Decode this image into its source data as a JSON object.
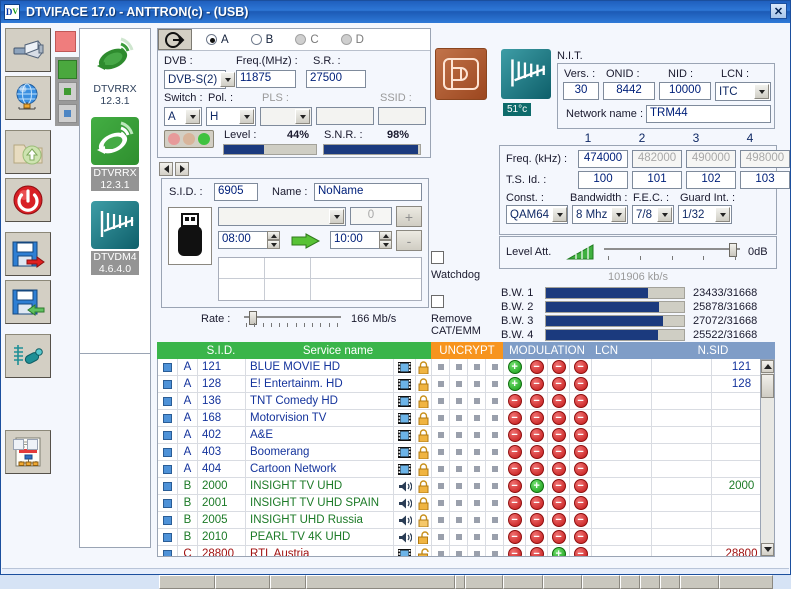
{
  "window": {
    "title": "DTVIFACE 17.0 - ANTTRON(c) - (USB)",
    "close_label": "✕",
    "app_icon": "dtv-logo-icon"
  },
  "toolbar": {
    "buttons": [
      {
        "name": "usb-connect-button",
        "icon": "usb-plug-icon",
        "title": "USB"
      },
      {
        "name": "network-connect-button",
        "icon": "globe-network-icon",
        "title": "Network"
      },
      {
        "name": "open-file-button",
        "icon": "folder-upload-icon",
        "title": "Open"
      },
      {
        "name": "power-button",
        "icon": "power-icon",
        "title": "Power"
      },
      {
        "name": "save-to-device-button",
        "icon": "floppy-arrow-right-icon",
        "title": "Write"
      },
      {
        "name": "read-from-device-button",
        "icon": "floppy-arrow-left-icon",
        "title": "Read"
      },
      {
        "name": "antenna-measure-button",
        "icon": "antenna-meter-icon",
        "title": "Measure"
      },
      {
        "name": "report-button",
        "icon": "report-document-icon",
        "title": "Report"
      }
    ]
  },
  "status_leds": {
    "red": "#e86f6f",
    "green": "#59b04d",
    "small_green": "#59b04d",
    "small_blue": "#5b8fc9"
  },
  "devices": [
    {
      "name": "DTVRRX",
      "version": "12.3.1",
      "selected": false,
      "icon": "satellite-dish-icon"
    },
    {
      "name": "DTVRRX",
      "version": "12.3.1",
      "selected": true,
      "icon": "satellite-dish-icon"
    },
    {
      "name": "DTVDM4",
      "version": "4.6.4.0",
      "selected": true,
      "icon": "yagi-antenna-icon"
    }
  ],
  "tuner": {
    "tabs": [
      {
        "label": "A",
        "selected": true,
        "enabled": true
      },
      {
        "label": "B",
        "selected": false,
        "enabled": true
      },
      {
        "label": "C",
        "selected": false,
        "enabled": false
      },
      {
        "label": "D",
        "selected": false,
        "enabled": false
      }
    ],
    "labels": {
      "dvb": "DVB :",
      "freq": "Freq.(MHz) :",
      "sr": "S.R. :",
      "switch": "Switch :",
      "pol": "Pol. :",
      "pls": "PLS :",
      "ssid": "SSID :",
      "level": "Level :",
      "snr": "S.N.R. :"
    },
    "dvb_value": "DVB-S(2)",
    "freq_value": "11875",
    "sr_value": "27500",
    "switch_value": "A",
    "pol_value": "H",
    "pls_value": "",
    "ssid_value": "",
    "level_pct": "44%",
    "level_fill": 44,
    "snr_pct": "98%",
    "snr_fill": 98
  },
  "service": {
    "sid_label": "S.I.D. :",
    "sid_value": "6905",
    "name_label": "Name :",
    "name_value": "NoName",
    "epg_dropdown_value": "",
    "epg_count_value": "0",
    "add_label": "+",
    "remove_label": "-",
    "time_start": "08:00",
    "time_end": "10:00",
    "usb_icon": "usb-stick-icon",
    "arrow_icon": "green-arrow-right-icon",
    "rate_label": "Rate :",
    "rate_value": "166 Mb/s",
    "rate_pos_pct": 5
  },
  "options": {
    "watchdog_label": "Watchdog",
    "watchdog_checked": false,
    "remove_cat_emm_label": "Remove\nCAT/EMM",
    "remove_cat_emm_line1": "Remove",
    "remove_cat_emm_line2": "CAT/EMM",
    "remove_cat_emm_checked": false
  },
  "cam": {
    "icon": "cam-module-icon",
    "color": "#b0562a"
  },
  "nit": {
    "antenna_icon": "yagi-antenna-icon",
    "temperature": "51°c",
    "title": "N.I.T.",
    "vers_label": "Vers. :",
    "vers_value": "30",
    "onid_label": "ONID :",
    "onid_value": "8442",
    "nid_label": "NID :",
    "nid_value": "10000",
    "lcn_label": "LCN :",
    "lcn_value": "ITC",
    "network_name_label": "Network name :",
    "network_name_value": "TRM44"
  },
  "output": {
    "column_headers": [
      "1",
      "2",
      "3",
      "4"
    ],
    "freq_label": "Freq. (kHz) :",
    "freq_values": [
      "474000",
      "482000",
      "490000",
      "498000"
    ],
    "freq_enabled": [
      true,
      false,
      false,
      false
    ],
    "ts_label": "T.S. Id. :",
    "ts_values": [
      "100",
      "101",
      "102",
      "103"
    ],
    "const_label": "Const. :",
    "const_value": "QAM64",
    "bandwidth_label": "Bandwidth :",
    "bandwidth_value": "8 Mhz",
    "fec_label": "F.E.C. :",
    "fec_value": "7/8",
    "guard_label": "Guard Int. :",
    "guard_value": "1/32",
    "level_att_label": "Level Att.",
    "level_att_value": "0dB",
    "level_att_pos_pct": 92,
    "bitrate": "101906 kb/s",
    "bw_rows": [
      {
        "label": "B.W. 1",
        "value": "23433/31668",
        "pct": 74
      },
      {
        "label": "B.W. 2",
        "value": "25878/31668",
        "pct": 82
      },
      {
        "label": "B.W. 3",
        "value": "27072/31668",
        "pct": 85
      },
      {
        "label": "B.W. 4",
        "value": "25522/31668",
        "pct": 81
      }
    ]
  },
  "table": {
    "headers": {
      "select": "",
      "tuner": "",
      "sid": "S.I.D.",
      "service_name": "Service name",
      "uncrypt": "UNCRYPT",
      "modulation": "MODULATION",
      "lcn": "LCN",
      "nsid": "N.SID"
    },
    "rows": [
      {
        "tuner": "A",
        "sid": "121",
        "name": "BLUE MOVIE HD",
        "color": "blue",
        "type": "video",
        "lock": "locked",
        "mod": [
          1,
          0,
          0,
          0
        ],
        "lcn": "",
        "nsid": "121"
      },
      {
        "tuner": "A",
        "sid": "128",
        "name": "E! Entertainm. HD",
        "color": "blue",
        "type": "video",
        "lock": "locked",
        "mod": [
          1,
          0,
          0,
          0
        ],
        "lcn": "",
        "nsid": "128"
      },
      {
        "tuner": "A",
        "sid": "136",
        "name": "TNT Comedy HD",
        "color": "blue",
        "type": "video",
        "lock": "locked",
        "mod": [
          0,
          0,
          0,
          0
        ],
        "lcn": "",
        "nsid": ""
      },
      {
        "tuner": "A",
        "sid": "168",
        "name": "Motorvision TV",
        "color": "blue",
        "type": "video",
        "lock": "locked",
        "mod": [
          0,
          0,
          0,
          0
        ],
        "lcn": "",
        "nsid": ""
      },
      {
        "tuner": "A",
        "sid": "402",
        "name": "A&E",
        "color": "blue",
        "type": "video",
        "lock": "locked",
        "mod": [
          0,
          0,
          0,
          0
        ],
        "lcn": "",
        "nsid": ""
      },
      {
        "tuner": "A",
        "sid": "403",
        "name": "Boomerang",
        "color": "blue",
        "type": "video",
        "lock": "locked",
        "mod": [
          0,
          0,
          0,
          0
        ],
        "lcn": "",
        "nsid": ""
      },
      {
        "tuner": "A",
        "sid": "404",
        "name": "Cartoon Network",
        "color": "blue",
        "type": "video",
        "lock": "locked",
        "mod": [
          0,
          0,
          0,
          0
        ],
        "lcn": "",
        "nsid": ""
      },
      {
        "tuner": "B",
        "sid": "2000",
        "name": "INSIGHT TV UHD",
        "color": "green",
        "type": "audio",
        "lock": "locked",
        "mod": [
          0,
          1,
          0,
          0
        ],
        "lcn": "",
        "nsid": "2000"
      },
      {
        "tuner": "B",
        "sid": "2001",
        "name": "INSIGHT TV UHD SPAIN",
        "color": "green",
        "type": "audio",
        "lock": "locked",
        "mod": [
          0,
          0,
          0,
          0
        ],
        "lcn": "",
        "nsid": ""
      },
      {
        "tuner": "B",
        "sid": "2005",
        "name": "INSIGHT UHD Russia",
        "color": "green",
        "type": "audio",
        "lock": "locked",
        "mod": [
          0,
          0,
          0,
          0
        ],
        "lcn": "",
        "nsid": ""
      },
      {
        "tuner": "B",
        "sid": "2010",
        "name": "PEARL TV 4K UHD",
        "color": "green",
        "type": "audio",
        "lock": "unlocked",
        "mod": [
          0,
          0,
          0,
          0
        ],
        "lcn": "",
        "nsid": ""
      },
      {
        "tuner": "C",
        "sid": "28800",
        "name": "RTL Austria",
        "color": "red",
        "type": "video",
        "lock": "unlocked",
        "mod": [
          0,
          0,
          1,
          0
        ],
        "lcn": "",
        "nsid": "28800"
      }
    ]
  },
  "colors": {
    "header_green": "#3ab54a",
    "header_orange": "#f7941e",
    "header_blue": "#7f9dc7",
    "bar_blue": "#1b3a7e",
    "title_blue": "#2e77d6"
  }
}
